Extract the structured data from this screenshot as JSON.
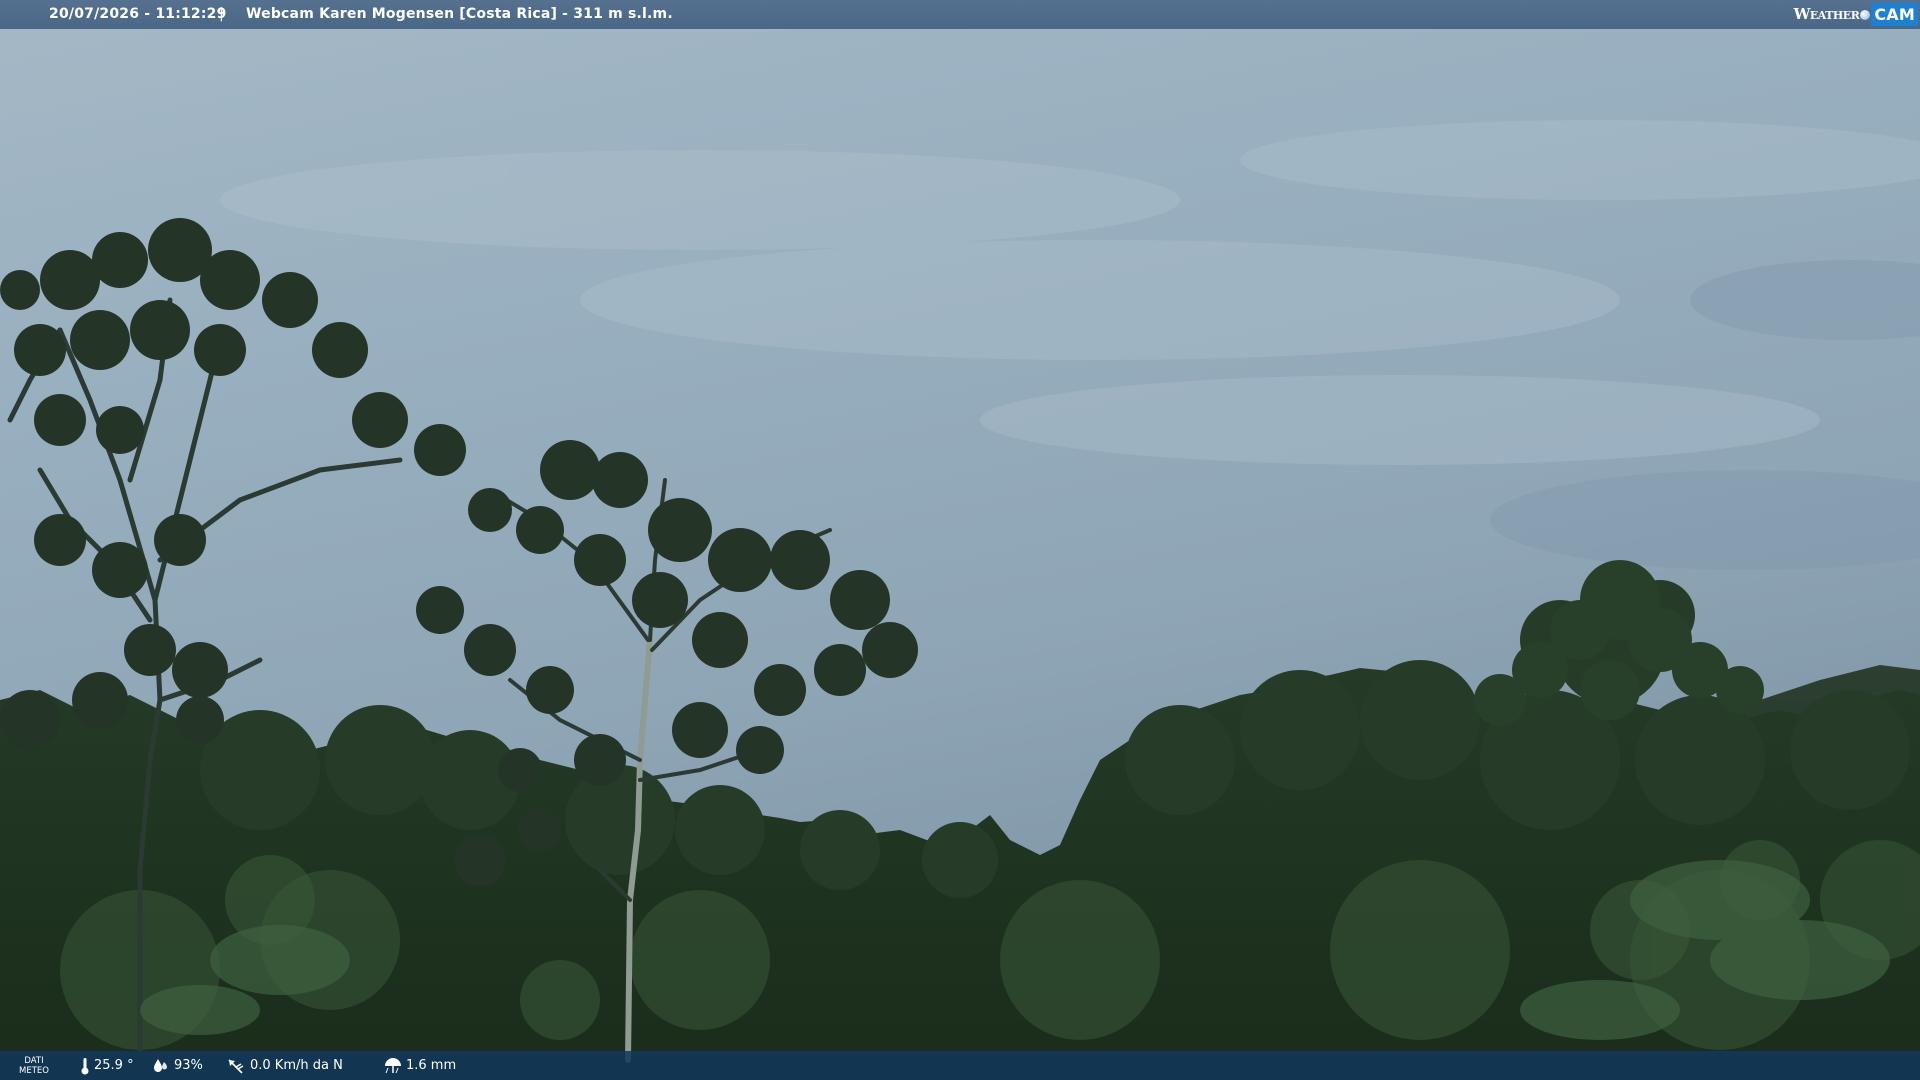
{
  "overlay": {
    "datetime": "20/07/2026 - 11:12:29",
    "separator": "|",
    "title": "Webcam Karen Mogensen [Costa Rica]  - 311 m s.l.m.",
    "logo_left": "Weather",
    "logo_right": "CAM"
  },
  "weather": {
    "label_line1": "DATI",
    "label_line2": "METEO",
    "temperature": "25.9 °",
    "humidity": "93%",
    "wind": "0.0 Km/h da N",
    "rain": "1.6 mm"
  },
  "icons": {
    "temperature": "thermometer-icon",
    "humidity": "humidity-drop-icon",
    "wind": "wind-vane-icon",
    "rain": "rain-umbrella-icon",
    "logo": "weathercam-logo"
  },
  "colors": {
    "top_bar": "#4f6b8b",
    "bottom_bar": "#143a5e",
    "logo_accent": "#1f7fd0",
    "sky": "#8aa2b4",
    "forest": "#1f3121"
  }
}
